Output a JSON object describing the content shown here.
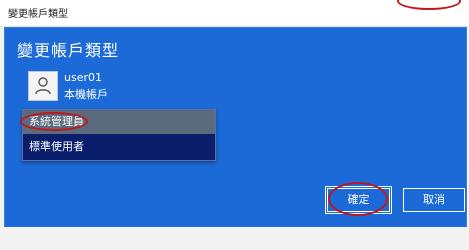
{
  "window": {
    "title": "變更帳戶類型"
  },
  "dialog": {
    "heading": "變更帳戶類型",
    "user": {
      "name": "user01",
      "account_type": "本機帳戶",
      "avatar_icon": "user-avatar-icon"
    },
    "account_type_select": {
      "options": [
        "系統管理員",
        "標準使用者"
      ],
      "selected_index": 0
    },
    "buttons": {
      "ok_label": "確定",
      "cancel_label": "取消"
    }
  },
  "colors": {
    "dialog_background": "#1c6ad8",
    "dropdown_background": "#0b1e6b",
    "selected_option": "#5a6b7e",
    "annotation": "#c0161c"
  }
}
